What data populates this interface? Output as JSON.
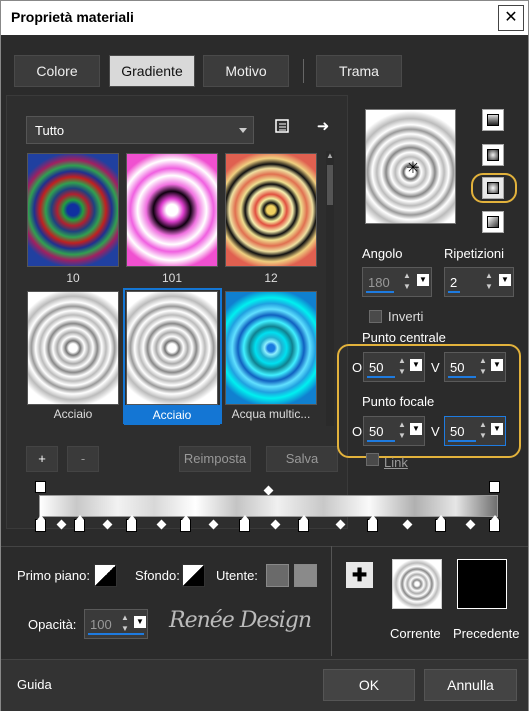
{
  "window": {
    "title": "Proprietà materiali",
    "close_symbol": "✕"
  },
  "tabs": [
    {
      "label": "Colore",
      "active": false
    },
    {
      "label": "Gradiente",
      "active": true
    },
    {
      "label": "Motivo",
      "active": false
    },
    {
      "label": "Trama",
      "active": false
    }
  ],
  "category": {
    "selected": "Tutto"
  },
  "thumbnails": [
    {
      "label": "10",
      "colors": "red-green-blue rings"
    },
    {
      "label": "101",
      "colors": "pink-black-white rings"
    },
    {
      "label": "12",
      "colors": "orange-yellow-black rings"
    },
    {
      "label": "Acciaio",
      "colors": "grey-white rings"
    },
    {
      "label": "Acciaio",
      "colors": "grey-white rings",
      "selected": true
    },
    {
      "label": "Acqua multic...",
      "colors": "cyan-blue rings"
    }
  ],
  "gradient_buttons": {
    "add": "+",
    "remove": "-",
    "reset": "Reimposta",
    "save": "Salva"
  },
  "properties": {
    "angle_label": "Angolo",
    "angle_value": "180",
    "repeats_label": "Ripetizioni",
    "repeats_value": "2",
    "invert_label": "Inverti",
    "center_label": "Punto centrale",
    "center_h_label": "O",
    "center_h": "50",
    "center_v_label": "V",
    "center_v": "50",
    "focal_label": "Punto focale",
    "focal_h_label": "O",
    "focal_h": "50",
    "focal_v_label": "V",
    "focal_v": "50",
    "link_label": "Link"
  },
  "colors": {
    "foreground_label": "Primo piano:",
    "background_label": "Sfondo:",
    "user_label": "Utente:",
    "opacity_label": "Opacità:",
    "opacity_value": "100",
    "accent": "#1476d4",
    "highlight": "#e2b23c"
  },
  "watermark": "Renée Design",
  "comparison": {
    "current_label": "Corrente",
    "previous_label": "Precedente"
  },
  "footer": {
    "help": "Guida",
    "ok": "OK",
    "cancel": "Annulla"
  }
}
